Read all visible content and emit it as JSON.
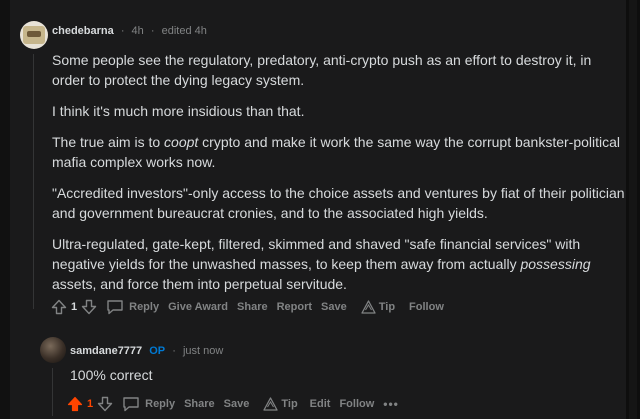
{
  "colors": {
    "background": "#1a1a1b",
    "text": "#d7dadc",
    "meta": "#818384",
    "op_badge": "#0079d3",
    "upvoted": "#ff4500"
  },
  "comment1": {
    "username": "chedebarna",
    "age": "4h",
    "edited": "edited 4h",
    "avatar_icon": "user-avatar",
    "paragraphs": [
      {
        "text": "Some people see the regulatory, predatory, anti-crypto push as an effort to destroy it, in order to protect the dying legacy system."
      },
      {
        "text": "I think it's much more insidious than that."
      },
      {
        "before": "The true aim is to ",
        "em": "coopt",
        "after": " crypto and make it work the same way the corrupt bankster-political mafia complex works now."
      },
      {
        "text": "\"Accredited investors\"-only access to the choice assets and ventures by fiat of their politician and government bureaucrat cronies, and to the associated high yields."
      },
      {
        "before": "Ultra-regulated, gate-kept, filtered, skimmed and shaved \"safe financial services\" with negative yields for the unwashed masses, to keep them away from actually ",
        "em": "possessing",
        "after": " assets, and force them into perpetual servitude."
      }
    ],
    "score": "1",
    "actions": {
      "reply": "Reply",
      "give_award": "Give Award",
      "share": "Share",
      "report": "Report",
      "save": "Save",
      "tip": "Tip",
      "follow": "Follow"
    }
  },
  "comment2": {
    "username": "samdane7777",
    "op_badge": "OP",
    "age": "just now",
    "avatar_icon": "user-avatar",
    "body": "100% correct",
    "score": "1",
    "upvoted": true,
    "actions": {
      "reply": "Reply",
      "share": "Share",
      "save": "Save",
      "tip": "Tip",
      "edit": "Edit",
      "follow": "Follow",
      "more": "•••"
    }
  }
}
